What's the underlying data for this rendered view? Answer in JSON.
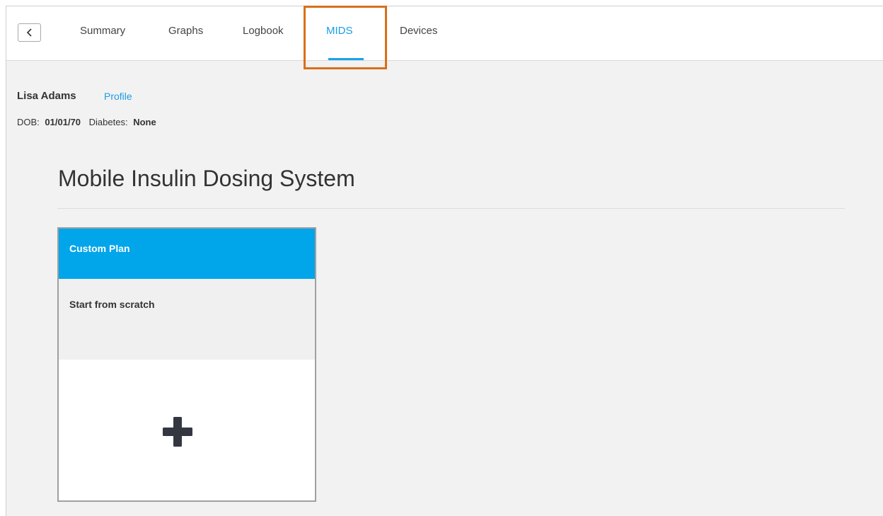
{
  "nav": {
    "back_icon": "chevron-left-icon",
    "tabs": [
      {
        "label": "Summary"
      },
      {
        "label": "Graphs"
      },
      {
        "label": "Logbook"
      },
      {
        "label": "MIDS"
      },
      {
        "label": "Devices"
      }
    ],
    "active_tab": "MIDS",
    "accent_color": "#1a9ee6",
    "highlight_color": "#d96f19"
  },
  "patient": {
    "name": "Lisa Adams",
    "profile_link": "Profile",
    "dob_label": "DOB:",
    "dob_value": "01/01/70",
    "diabetes_label": "Diabetes:",
    "diabetes_value": "None"
  },
  "main": {
    "title": "Mobile Insulin Dosing System",
    "plan_card": {
      "title": "Custom Plan",
      "subtitle": "Start from scratch",
      "header_color": "#00a5ea",
      "add_icon": "plus-icon"
    }
  }
}
